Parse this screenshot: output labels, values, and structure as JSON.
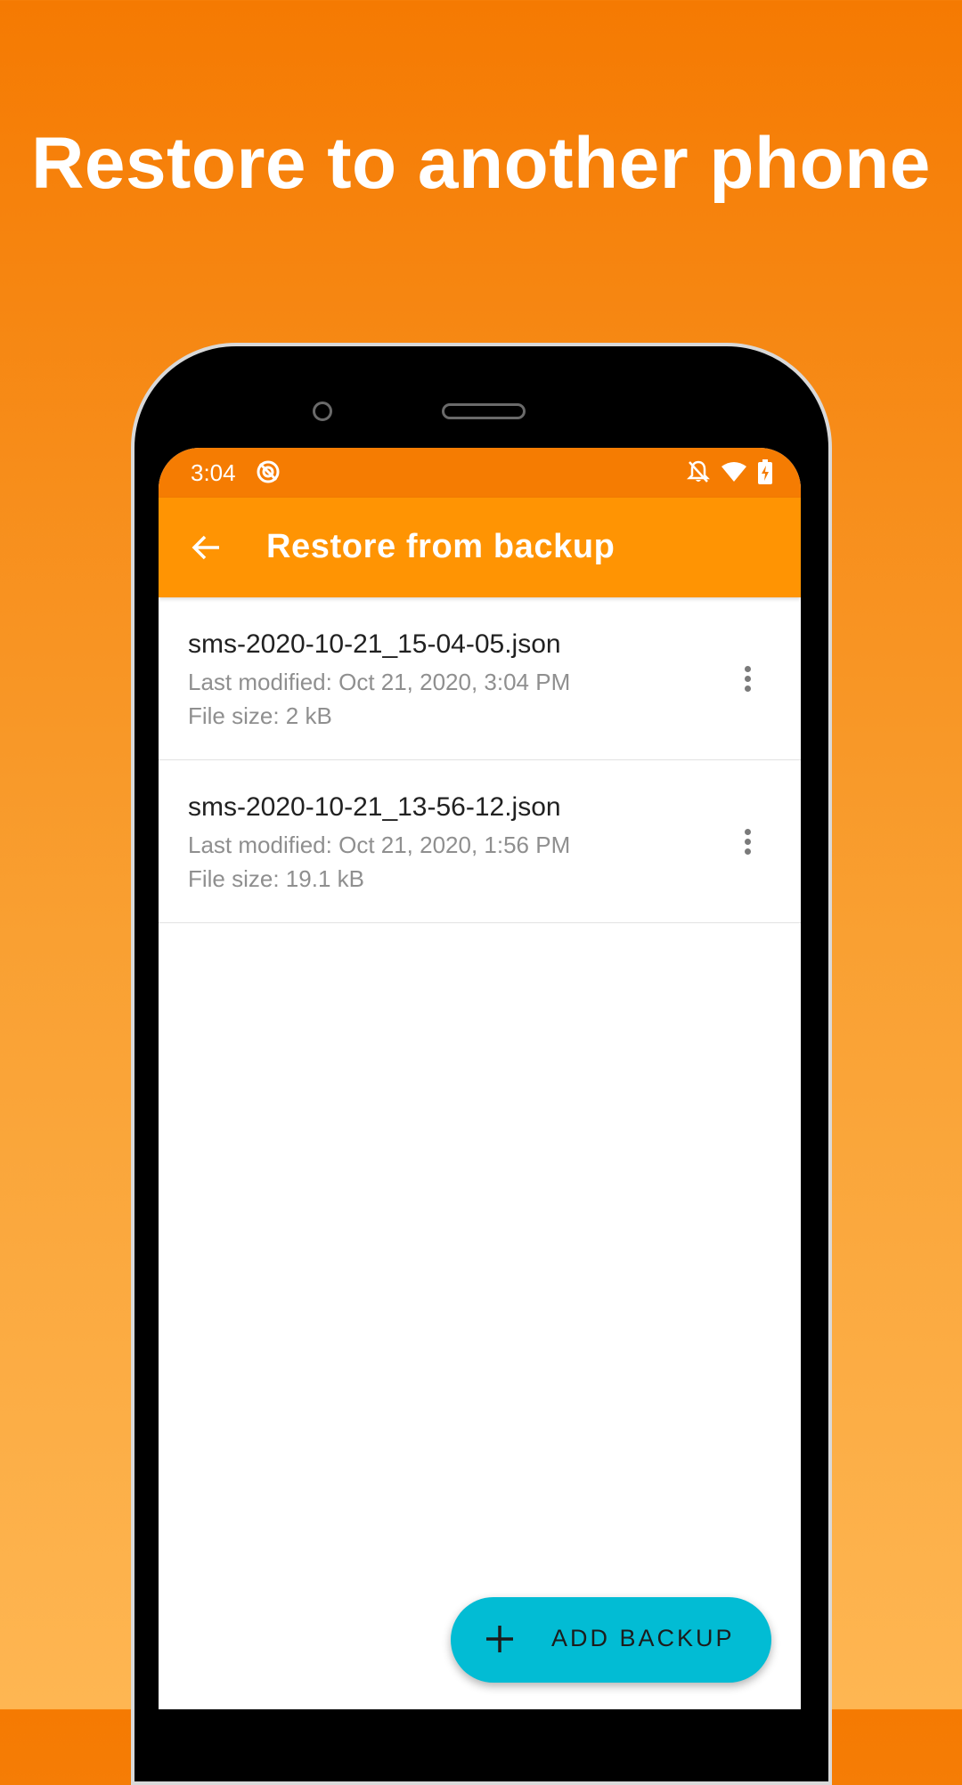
{
  "promo": {
    "headline": "Restore to another phone"
  },
  "status_bar": {
    "time": "3:04",
    "icons": [
      "sync-icon",
      "bell-off-icon",
      "wifi-icon",
      "battery-charging-icon"
    ]
  },
  "app_bar": {
    "back_icon": "arrow-back-icon",
    "title": "Restore from backup"
  },
  "backups": [
    {
      "file_name": "sms-2020-10-21_15-04-05.json",
      "last_modified": "Last modified: Oct 21, 2020, 3:04 PM",
      "file_size": "File size: 2 kB"
    },
    {
      "file_name": "sms-2020-10-21_13-56-12.json",
      "last_modified": "Last modified: Oct 21, 2020, 1:56 PM",
      "file_size": "File size: 19.1 kB"
    }
  ],
  "fab": {
    "icon": "plus-icon",
    "label": "ADD BACKUP"
  },
  "colors": {
    "status_bar": "#F57C02",
    "app_bar": "#FF9403",
    "fab": "#02BCD4",
    "background_top": "#F57A02",
    "background_bottom": "#FEB652"
  }
}
